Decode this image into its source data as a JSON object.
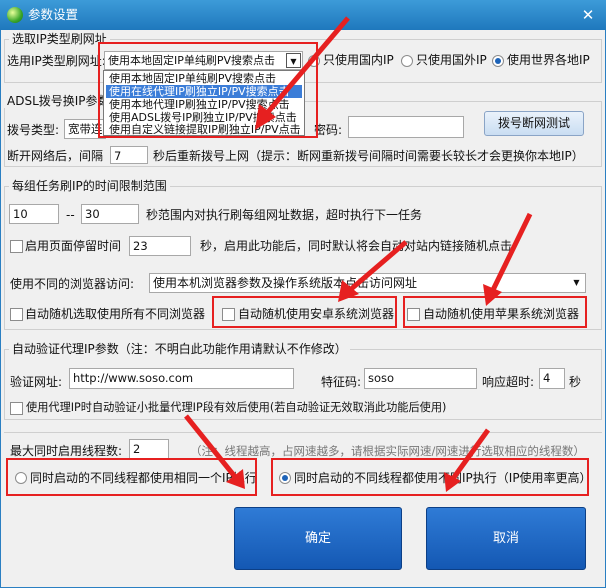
{
  "window": {
    "title": "参数设置",
    "close_glyph": "✕"
  },
  "url_type": {
    "legend": "选取IP类型刷网址",
    "label": "选用IP类型刷网址:",
    "selected": "使用本地固定IP单纯刷PV搜索点击",
    "options": [
      "使用本地固定IP单纯刷PV搜索点击",
      "使用在线代理IP刷独立IP/PV搜索点击",
      "使用本地代理IP刷独立IP/PV搜索点击",
      "使用ADSL拨号IP刷独立IP/PV搜索点击",
      "使用自定义链接提取IP刷独立IP/PV点击"
    ],
    "highlighted_index": 1,
    "radio_domestic": "只使用国内IP",
    "radio_foreign": "只使用国外IP",
    "radio_world": "使用世界各地IP"
  },
  "adsl": {
    "legend": "ADSL拨号换IP参数",
    "dial_type_label": "拨号类型:",
    "dial_type_value": "宽带连接",
    "password_label": "密码:",
    "password_value": "",
    "test_button": "拨号断网测试",
    "reconnect_prefix": "断开网络后，间隔",
    "reconnect_value": "7",
    "reconnect_suffix": "秒后重新拨号上网（提示：断网重新拨号间隔时间需要长较长才会更换你本地IP）"
  },
  "task_time": {
    "legend": "每组任务刷IP的时间限制范围",
    "min": "10",
    "dash": "--",
    "max": "30",
    "range_text": "秒范围内对执行刷每组网址数据，超时执行下一任务",
    "page_stay_label": "启用页面停留时间",
    "page_stay_value": "23",
    "page_stay_text": "秒，启用此功能后，同时默认将会自动对站内链接随机点击",
    "browser_label": "使用不同的浏览器访问:",
    "browser_value": "使用本机浏览器参数及操作系统版本点击访问网址",
    "random_all": "自动随机选取使用所有不同浏览器",
    "random_android": "自动随机使用安卓系统浏览器",
    "random_apple": "自动随机使用苹果系统浏览器"
  },
  "proxy_verify": {
    "legend": "自动验证代理IP参数（注：不明白此功能作用请默认不作修改）",
    "url_label": "验证网址:",
    "url_value": "http://www.soso.com",
    "code_label": "特征码:",
    "code_value": "soso",
    "timeout_label": "响应超时:",
    "timeout_value": "4",
    "timeout_unit": "秒",
    "auto_verify_label": "使用代理IP时自动验证小批量代理IP段有效后使用(若自动验证无效取消此功能后使用)"
  },
  "threads": {
    "max_label": "最大同时启用线程数:",
    "max_value": "2",
    "note": "（注：线程越高，占网速越多，请根据实际网速/网速进行选取相应的线程数）",
    "same_ip": "同时启动的不同线程都使用相同一个IP执行",
    "diff_ip": "同时启动的不同线程都使用不同IP执行（IP使用率更高）"
  },
  "buttons": {
    "ok": "确定",
    "cancel": "取消"
  },
  "colors": {
    "title_bar": "#2a86c9",
    "annotation_red": "#e62020",
    "big_button": "#1e66c4",
    "dropdown_highlight": "#3b7dd8"
  }
}
